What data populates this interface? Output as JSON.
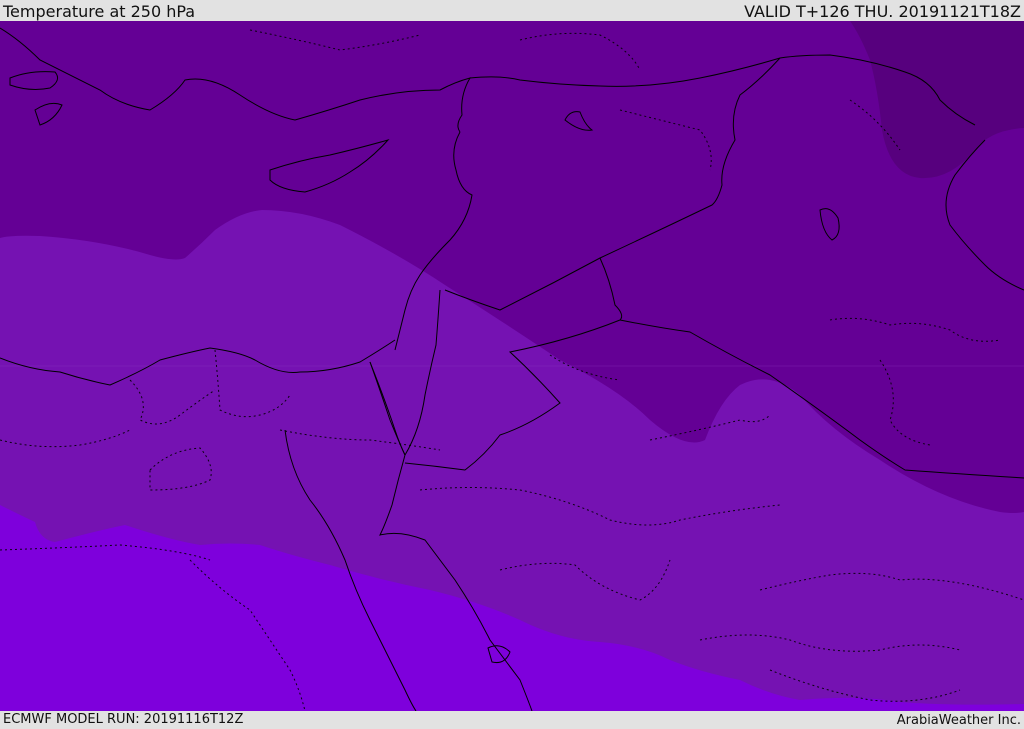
{
  "header": {
    "title": "Temperature at 250 hPa",
    "valid": "VALID T+126 THU. 20191121T18Z"
  },
  "footer": {
    "model_run": "ECMWF MODEL RUN: 20191116T12Z",
    "credit": "ArabiaWeather Inc."
  },
  "map": {
    "layer": "temperature-contour-fill",
    "bands": [
      {
        "name": "coldest-band",
        "color": "#57007e"
      },
      {
        "name": "cold-band",
        "color": "#640095"
      },
      {
        "name": "mid-band",
        "color": "#7512b2"
      },
      {
        "name": "warm-band",
        "color": "#7e00dc"
      }
    ],
    "line_colors": {
      "coastline": "#000000",
      "border": "#000000"
    }
  }
}
